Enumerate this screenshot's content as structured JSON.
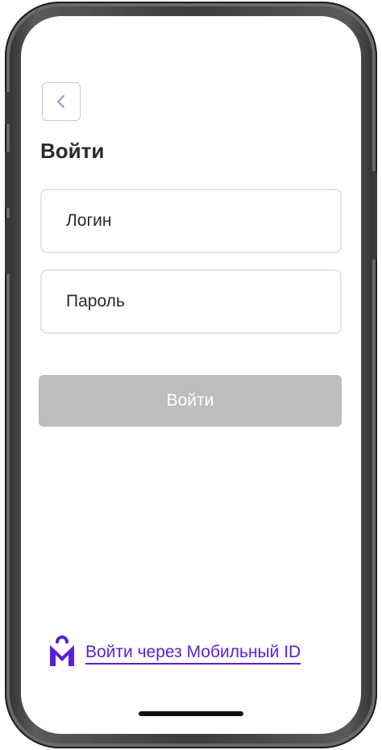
{
  "screen": {
    "title": "Войти"
  },
  "back_button": {
    "icon": "chevron-left-icon"
  },
  "login_field": {
    "placeholder": "Логин",
    "value": ""
  },
  "password_field": {
    "placeholder": "Пароль",
    "value": ""
  },
  "submit_button": {
    "label": "Войти",
    "state": "disabled"
  },
  "mobile_id_link": {
    "label": "Войти через Мобильный ID",
    "icon": "mobile-id-logo-icon"
  },
  "colors": {
    "accent": "#5a1fd6",
    "button_disabled": "#bdbdbd",
    "field_border": "#e4e2ef",
    "back_border": "#c9c6e4"
  }
}
